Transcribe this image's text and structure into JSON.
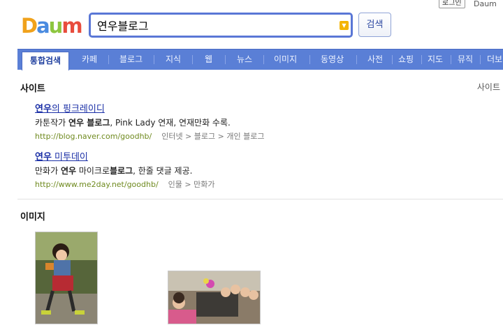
{
  "header": {
    "login_label": "로그인",
    "daum_link": "Daum"
  },
  "logo": {
    "letters": [
      "D",
      "a",
      "u",
      "m"
    ],
    "colors": [
      "#f0a21c",
      "#4a8be0",
      "#8dc63f",
      "#e84c3d"
    ]
  },
  "search": {
    "query": "연우블로그",
    "button_label": "검색"
  },
  "tabs": [
    {
      "label": "통합검색",
      "active": true
    },
    {
      "label": "카페"
    },
    {
      "label": "블로그"
    },
    {
      "label": "지식"
    },
    {
      "label": "웹"
    },
    {
      "label": "뉴스"
    },
    {
      "label": "이미지"
    },
    {
      "label": "동영상"
    },
    {
      "label": "사전"
    },
    {
      "label": "쇼핑"
    },
    {
      "label": "지도"
    },
    {
      "label": "뮤직"
    },
    {
      "label": "더보"
    }
  ],
  "site_section": {
    "title": "사이트",
    "more_label": "사이트",
    "results": [
      {
        "title_bold": "연우",
        "title_rest": "의 핑크레이디",
        "desc_pre": "카툰작가 ",
        "desc_bold": "연우 블로그",
        "desc_post": ", Pink Lady 연재, 연재만화 수록.",
        "url": "http://blog.naver.com/goodhb/",
        "path": "인터넷 > 블로그 > 개인 블로그"
      },
      {
        "title_bold": "연우",
        "title_rest": " 미투데이",
        "desc_pre": "만화가 ",
        "desc_bold": "연우",
        "desc_mid": " 마이크로",
        "desc_bold2": "블로그",
        "desc_post": ", 한줄 댓글 제공.",
        "url": "http://www.me2day.net/goodhb/",
        "path": "인물 > 만화가"
      }
    ]
  },
  "image_section": {
    "title": "이미지"
  },
  "colors": {
    "tab_bar": "#5a7fd6",
    "link": "#1a2fa6",
    "url": "#6f8a1f"
  }
}
